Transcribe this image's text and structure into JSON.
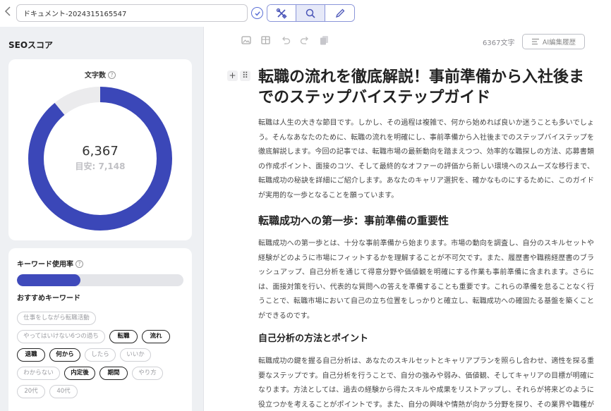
{
  "header": {
    "back_icon": "chevron-left-icon",
    "document_title": "ドキュメント-2024315165547",
    "tools": [
      {
        "name": "tools-icon",
        "active": false
      },
      {
        "name": "search-icon",
        "active": true
      },
      {
        "name": "pencil-icon",
        "active": false
      }
    ]
  },
  "sidebar": {
    "title": "SEOスコア",
    "char_card": {
      "label": "文字数",
      "help": "?",
      "value": "6,367",
      "target": "目安: 7,148",
      "progress": 0.8907,
      "ring_color": "#3b47b8",
      "ring_bg": "#ebebed"
    },
    "keyword_card": {
      "title": "キーワード使用率",
      "help": "?",
      "usage": 0.38,
      "bar_color": "#3f4abb",
      "recommended_title": "おすすめキーワード",
      "chips": [
        {
          "label": "仕事をしながら転職活動",
          "used": false
        },
        {
          "label": "やってはいけない6つの過ち",
          "used": false
        },
        {
          "label": "転職",
          "used": true
        },
        {
          "label": "流れ",
          "used": true
        },
        {
          "label": "退職",
          "used": true
        },
        {
          "label": "何から",
          "used": true
        },
        {
          "label": "したら",
          "used": false
        },
        {
          "label": "いいか",
          "used": false
        },
        {
          "label": "わからない",
          "used": false
        },
        {
          "label": "内定後",
          "used": true
        },
        {
          "label": "期間",
          "used": true
        },
        {
          "label": "やり方",
          "used": false
        },
        {
          "label": "20代",
          "used": false
        },
        {
          "label": "40代",
          "used": false
        }
      ]
    }
  },
  "editor": {
    "toolbar": {
      "char_count": "6367文字",
      "history_label": "AI編集履歴"
    },
    "block_add": "+",
    "block_drag": "⠿",
    "title": "転職の流れを徹底解説！事前準備から入社後までのステップバイステップガイド",
    "intro": "転職は人生の大きな節目です。しかし、その過程は複雑で、何から始めれば良いか迷うことも多いでしょう。そんなあなたのために、転職の流れを明確にし、事前準備から入社後までのステップバイステップを徹底解説します。今回の記事では、転職市場の最新動向を踏まえつつ、効率的な職探しの方法、応募書類の作成ポイント、面接のコツ、そして最終的なオファーの評価から新しい環境へのスムーズな移行まで、転職成功の秘訣を詳細にご紹介します。あなたのキャリア選択を、確かなものにするために、このガイドが実用的な一歩となることを願っています。",
    "section1_heading": "転職成功への第一歩：事前準備の重要性",
    "section1_body": "転職成功への第一歩とは、十分な事前準備から始まります。市場の動向を調査し、自分のスキルセットや経験がどのように市場にフィットするかを理解することが不可欠です。また、履歴書や職務経歴書のブラッシュアップ、自己分析を通じて得意分野や価値観を明確にする作業も事前準備に含まれます。さらには、面接対策を行い、代表的な質問への答えを準備することも重要です。これらの準備を怠ることなく行うことで、転職市場において自己の立ち位置をしっかりと確立し、転職成功への確固たる基盤を築くことができるのです。",
    "section2_heading": "自己分析の方法とポイント",
    "section2_body": "転職成功の鍵を握る自己分析は、あなたのスキルセットとキャリアプランを照らし合わせ、適性を探る重要なステップです。自己分析を行うことで、自分の強みや弱み、価値観、そしてキャリアの目標が明確になります。方法としては、過去の経験から得たスキルや成果をリストアップし、それらが将来どのように役立つかを考えることがポイントです。また、自分の興味や情熱が向かう分野を探り、その業界や職種が自分に合っているかを検討しましょう。正確な自"
  }
}
